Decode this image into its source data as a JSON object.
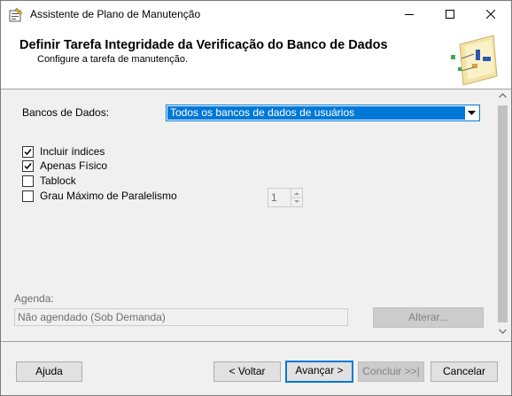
{
  "window": {
    "title": "Assistente de Plano de Manutenção",
    "minimize_icon": "minimize-icon",
    "maximize_icon": "maximize-icon",
    "close_icon": "close-icon"
  },
  "header": {
    "title": "Definir Tarefa Integridade da Verificação do Banco de Dados",
    "subtitle": "Configure a tarefa de manutenção."
  },
  "form": {
    "databases_label": "Bancos de Dados:",
    "databases_value": "Todos os bancos de dados de usuários",
    "options": [
      {
        "label": "Incluir índices",
        "checked": true
      },
      {
        "label": "Apenas Físico",
        "checked": true
      },
      {
        "label": "Tablock",
        "checked": false
      },
      {
        "label": "Grau Máximo de Paralelismo",
        "checked": false
      }
    ],
    "parallelism_value": "1"
  },
  "schedule": {
    "label": "Agenda:",
    "value": "Não agendado (Sob Demanda)",
    "change_button": "Alterar..."
  },
  "footer": {
    "help": "Ajuda",
    "back": "< Voltar",
    "next": "Avançar >",
    "finish": "Concluir >>|",
    "cancel": "Cancelar"
  },
  "colors": {
    "accent": "#0078d7",
    "disabled_text": "#838383"
  }
}
